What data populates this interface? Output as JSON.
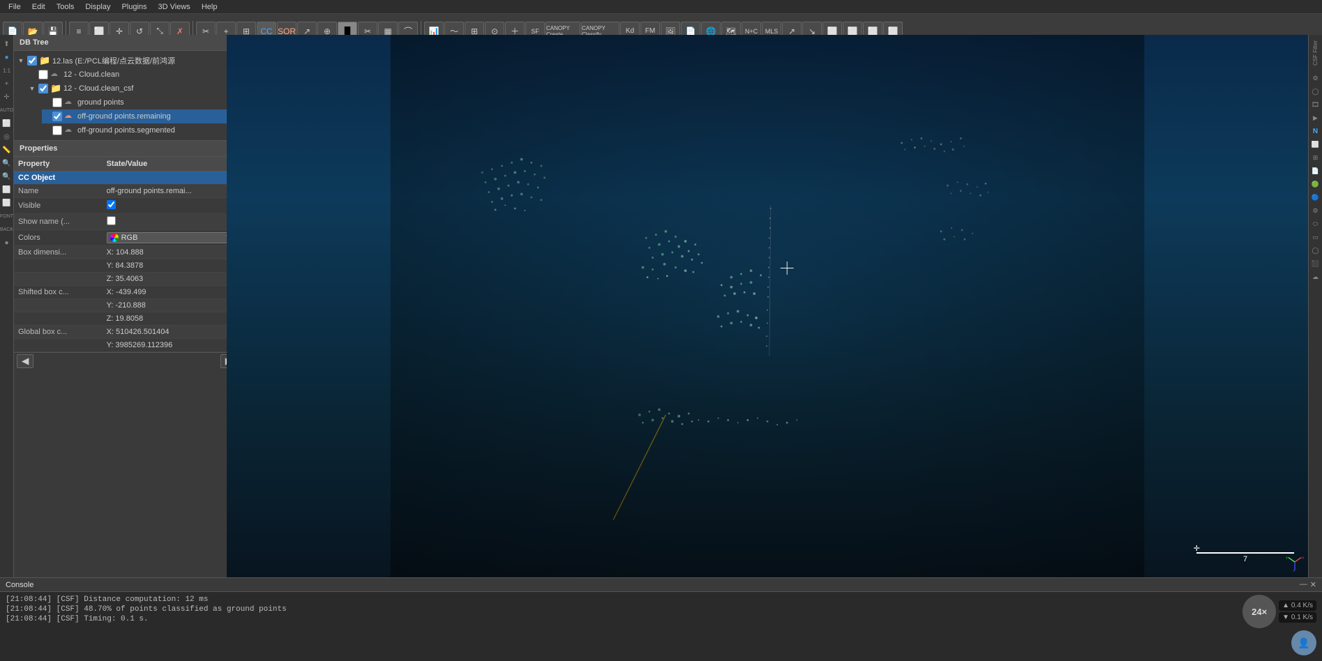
{
  "menubar": {
    "items": [
      "File",
      "Edit",
      "Tools",
      "Display",
      "Plugins",
      "3D Views",
      "Help"
    ]
  },
  "toolbar": {
    "buttons": [
      {
        "name": "open",
        "icon": "📂"
      },
      {
        "name": "save",
        "icon": "💾"
      },
      {
        "name": "properties",
        "icon": "📋"
      },
      {
        "name": "select",
        "icon": "⬜"
      },
      {
        "name": "translate",
        "icon": "✛"
      },
      {
        "name": "rotate",
        "icon": "↺"
      },
      {
        "name": "zoom",
        "icon": "🔍"
      },
      {
        "name": "delete",
        "icon": "✗"
      },
      {
        "name": "segment",
        "icon": "✂"
      },
      {
        "name": "add",
        "icon": "+"
      }
    ]
  },
  "db_tree": {
    "title": "DB Tree",
    "items": [
      {
        "id": "root",
        "label": "12.las (E:/PCL编程/点云数据/前鸿源",
        "indent": 0,
        "type": "file",
        "checked": true,
        "expanded": true
      },
      {
        "id": "cloud_clean",
        "label": "12 - Cloud.clean",
        "indent": 1,
        "type": "cloud",
        "checked": false,
        "expanded": false
      },
      {
        "id": "cloud_clean_csf",
        "label": "12 - Cloud.clean_csf",
        "indent": 1,
        "type": "folder",
        "checked": true,
        "expanded": true
      },
      {
        "id": "ground_points",
        "label": "ground points",
        "indent": 2,
        "type": "cloud",
        "checked": false,
        "expanded": false
      },
      {
        "id": "off_ground_remaining",
        "label": "off-ground points.remaining",
        "indent": 2,
        "type": "cloud",
        "checked": true,
        "expanded": false,
        "selected": true
      },
      {
        "id": "off_ground_segmented",
        "label": "off-ground points.segmented",
        "indent": 2,
        "type": "cloud",
        "checked": false,
        "expanded": false
      }
    ]
  },
  "properties": {
    "title": "Properties",
    "columns": [
      "Property",
      "State/Value"
    ],
    "rows": [
      {
        "section": "CC Object",
        "is_header": true
      },
      {
        "property": "Name",
        "value": "off-ground points.remai..."
      },
      {
        "property": "Visible",
        "value": "checkbox_checked"
      },
      {
        "property": "Show name (...",
        "value": "checkbox_unchecked"
      },
      {
        "property": "Colors",
        "value": "RGB"
      },
      {
        "property": "Box dimensi...",
        "value": "X: 104.888"
      },
      {
        "property": "",
        "value": "Y: 84.3878"
      },
      {
        "property": "",
        "value": "Z: 35.4063"
      },
      {
        "property": "Shifted box c...",
        "value": "X: -439.499"
      },
      {
        "property": "",
        "value": "Y: -210.888"
      },
      {
        "property": "",
        "value": "Z: 19.8058"
      },
      {
        "property": "Global box c...",
        "value": "X: 510426.501404"
      },
      {
        "property": "",
        "value": "Y: 3985269.112396"
      }
    ]
  },
  "viewport": {
    "crosshair_x": "50%",
    "crosshair_y": "46%"
  },
  "scale_bar": {
    "label": "7",
    "unit": ""
  },
  "console": {
    "title": "Console",
    "lines": [
      "[21:08:44] [CSF] Distance computation: 12 ms",
      "[21:08:44] [CSF] 48.70% of points classified as ground points",
      "[21:08:44] [CSF] Timing: 0.1 s."
    ]
  },
  "status": {
    "zoom": "24×",
    "fps": "0.4 K/s",
    "fps2": "0.1 K/s"
  },
  "csf_filter": {
    "label": "CSF Filter"
  },
  "right_sidebar": {
    "icons": [
      "⚙",
      "◯",
      "▶",
      "⬡",
      "N",
      "⬜",
      "⬛",
      "⚡",
      "📄",
      "🔴",
      "🔵",
      "⚙",
      "◯",
      "⬜",
      "◯",
      "⬛"
    ]
  }
}
